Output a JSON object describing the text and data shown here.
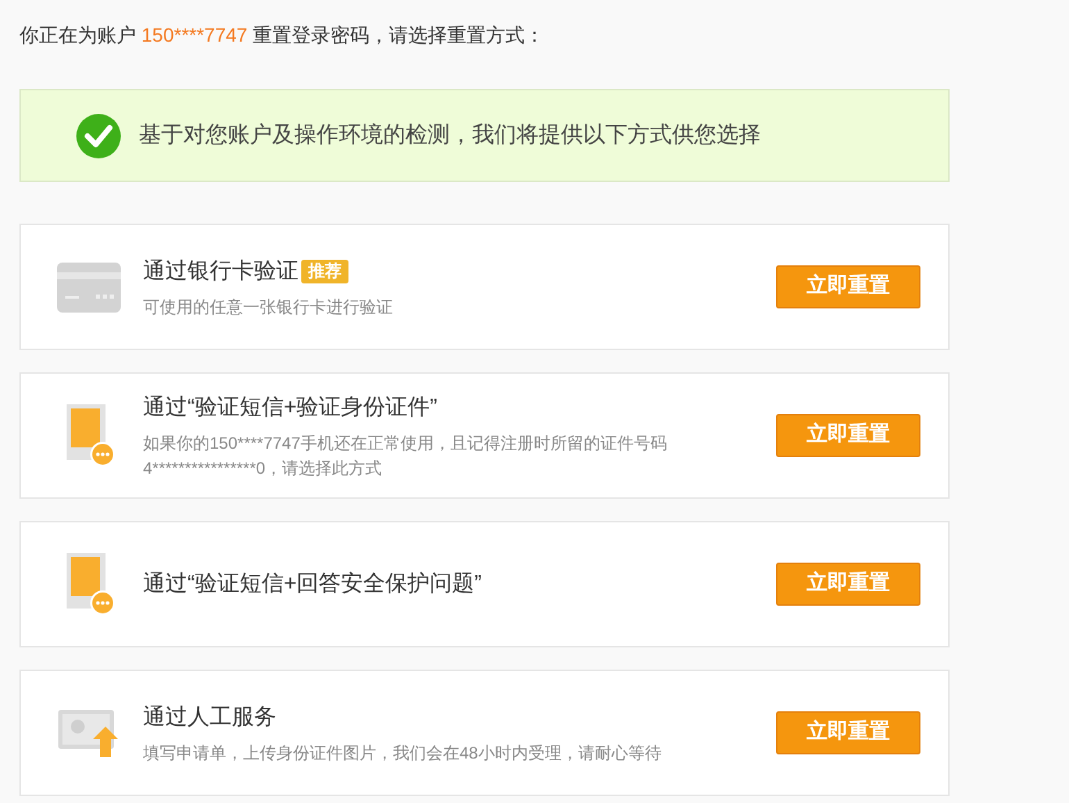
{
  "intro": {
    "prefix": "你正在为账户",
    "account": "150****7747",
    "suffix": "重置登录密码，请选择重置方式："
  },
  "notice": {
    "text": "基于对您账户及操作环境的检测，我们将提供以下方式供您选择"
  },
  "methods": [
    {
      "kind": "card",
      "title": "通过银行卡验证",
      "badge": "推荐",
      "description": "可使用的任意一张银行卡进行验证",
      "button": "立即重置"
    },
    {
      "kind": "phone",
      "title": "通过“验证短信+验证身份证件”",
      "description": "如果你的150****7747手机还在正常使用，且记得注册时所留的证件号码4****************0，请选择此方式",
      "button": "立即重置"
    },
    {
      "kind": "phone",
      "title": "通过“验证短信+回答安全保护问题”",
      "button": "立即重置"
    },
    {
      "kind": "upload",
      "title": "通过人工服务",
      "description": "填写申请单，上传身份证件图片，我们会在48小时内受理，请耐心等待",
      "button": "立即重置"
    }
  ]
}
